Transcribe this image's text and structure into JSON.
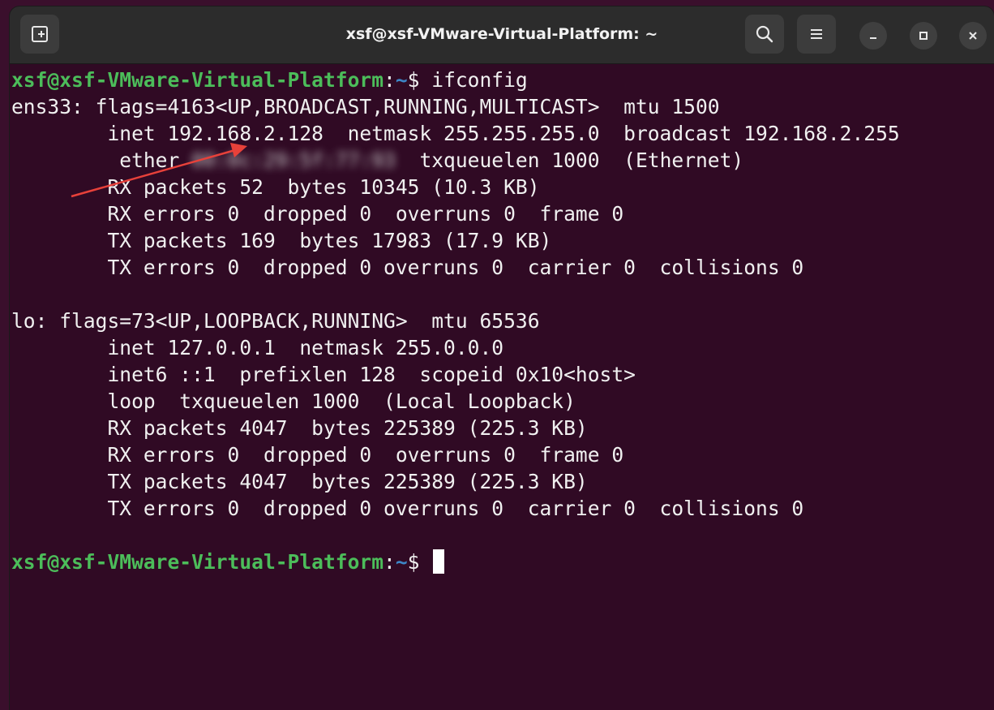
{
  "window": {
    "title": "xsf@xsf-VMware-Virtual-Platform: ~"
  },
  "icons": {
    "new_tab": "new-tab-icon",
    "search": "search-icon",
    "menu": "hamburger-menu-icon",
    "minimize": "minimize-icon",
    "maximize": "maximize-icon",
    "close": "close-icon",
    "annotation": "red-arrow-annotation"
  },
  "colors": {
    "terminal_bg": "#300a24",
    "prompt_user": "#4cbd5a",
    "prompt_path": "#3d86c6",
    "text": "#f0f0f0",
    "arrow": "#e8413a"
  },
  "terminal": {
    "prompt_user": "xsf@xsf-VMware-Virtual-Platform",
    "prompt_sep": ":",
    "prompt_path": "~",
    "prompt_symbol": "$ ",
    "command": "ifconfig",
    "ether_prefix": "         ether ",
    "ether_blurred": "00:0c:29:5f:77:93",
    "ether_suffix": "  txqueuelen 1000  (Ethernet)",
    "lines": [
      "ens33: flags=4163<UP,BROADCAST,RUNNING,MULTICAST>  mtu 1500",
      "        inet 192.168.2.128  netmask 255.255.255.0  broadcast 192.168.2.255",
      "        RX packets 52  bytes 10345 (10.3 KB)",
      "        RX errors 0  dropped 0  overruns 0  frame 0",
      "        TX packets 169  bytes 17983 (17.9 KB)",
      "        TX errors 0  dropped 0 overruns 0  carrier 0  collisions 0",
      "",
      "lo: flags=73<UP,LOOPBACK,RUNNING>  mtu 65536",
      "        inet 127.0.0.1  netmask 255.0.0.0",
      "        inet6 ::1  prefixlen 128  scopeid 0x10<host>",
      "        loop  txqueuelen 1000  (Local Loopback)",
      "        RX packets 4047  bytes 225389 (225.3 KB)",
      "        RX errors 0  dropped 0  overruns 0  frame 0",
      "        TX packets 4047  bytes 225389 (225.3 KB)",
      "        TX errors 0  dropped 0 overruns 0  carrier 0  collisions 0",
      ""
    ]
  }
}
